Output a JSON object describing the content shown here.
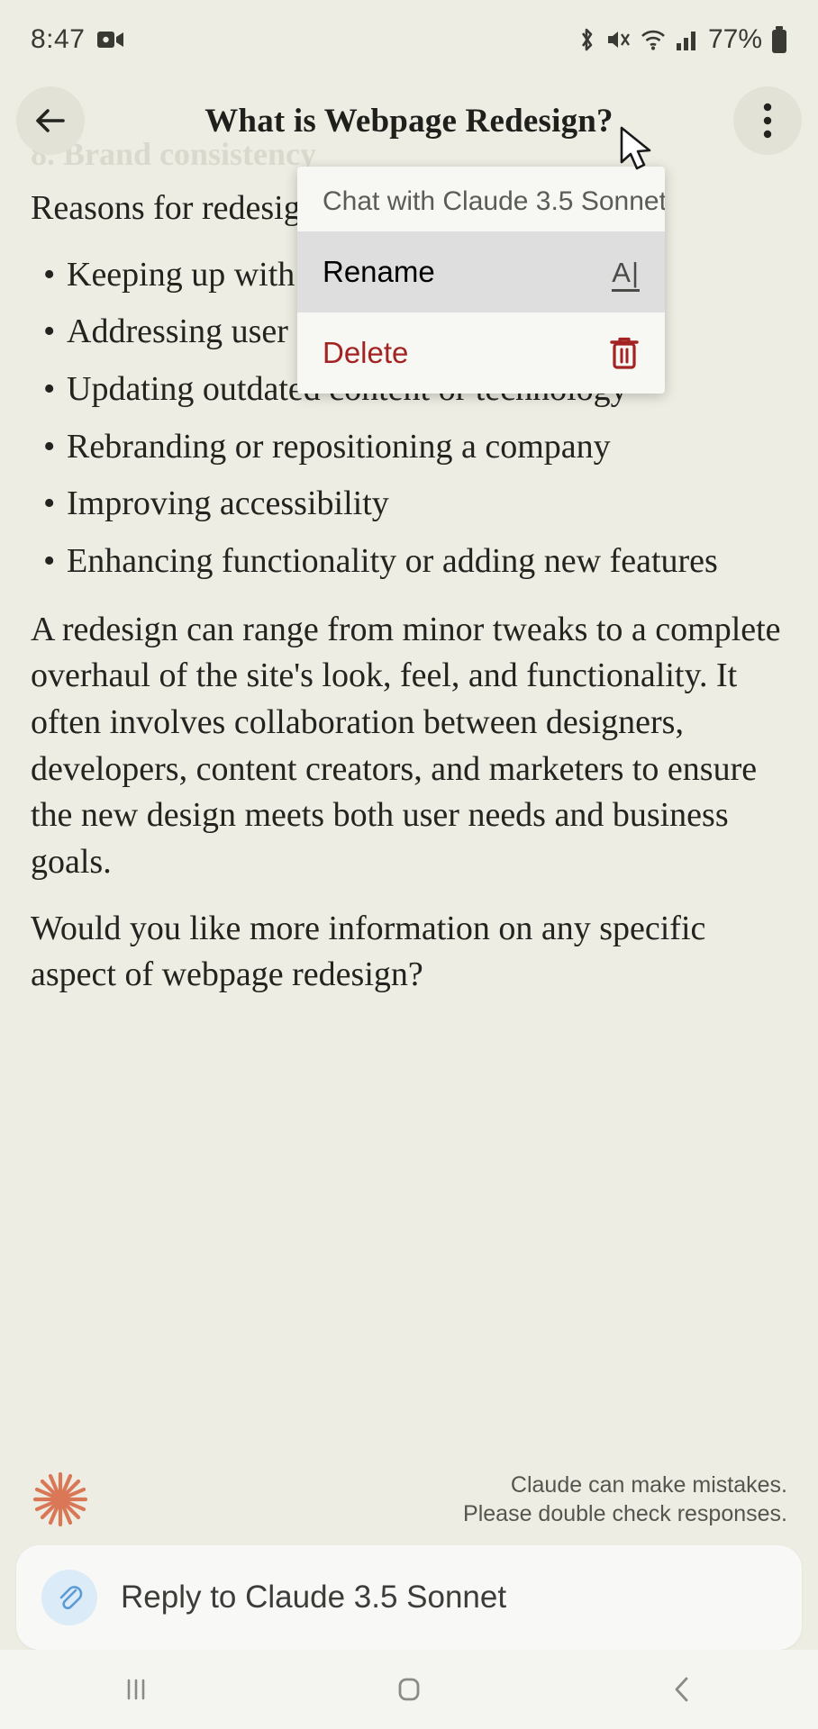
{
  "status_bar": {
    "time": "8:47",
    "battery_percent": "77%",
    "icons": [
      "video-record-icon",
      "bluetooth-icon",
      "mute-icon",
      "wifi-icon",
      "cellular-signal-icon",
      "battery-icon"
    ]
  },
  "header": {
    "back_label": "←",
    "title": "What is Webpage Redesign?",
    "overflow_label": "⋮"
  },
  "conversation": {
    "faded_heading": "8. Brand consistency",
    "intro": "Reasons for redesign include:",
    "bullets": [
      "Keeping up with design trends",
      "Addressing user feedback or analytics",
      "Updating outdated content or technology",
      "Rebranding or repositioning a company",
      "Improving accessibility",
      "Enhancing functionality or adding new features"
    ],
    "paragraph_1": "A redesign can range from minor tweaks to a complete overhaul of the site's look, feel, and functionality. It often involves collaboration between designers, developers, content creators, and marketers to ensure the new design meets both user needs and business goals.",
    "paragraph_2": "Would you like more information on any specific aspect of webpage redesign?"
  },
  "menu": {
    "header": "Chat with Claude 3.5 Sonnet",
    "items": [
      {
        "label": "Rename",
        "icon": "rename-text-icon",
        "icon_glyph": "A|",
        "state": "pressed",
        "color": "#23231f"
      },
      {
        "label": "Delete",
        "icon": "trash-icon",
        "state": "normal",
        "color": "#A32222"
      }
    ]
  },
  "footer": {
    "logo": "claude-starburst-logo",
    "logo_color": "#D97757",
    "disclaimer_line_1": "Claude can make mistakes.",
    "disclaimer_line_2": "Please double check responses."
  },
  "composer": {
    "attach_icon": "paperclip-icon",
    "placeholder": "Reply to Claude 3.5 Sonnet",
    "value": ""
  },
  "nav_bar": {
    "recents_label": "|||",
    "home_label": "home-square-icon",
    "back_label": "‹"
  },
  "colors": {
    "page_background": "#EDEDE3",
    "menu_background": "#F7F7F4",
    "pressed_row": "#DEDEDE",
    "danger": "#A32222",
    "accent": "#D97757"
  }
}
